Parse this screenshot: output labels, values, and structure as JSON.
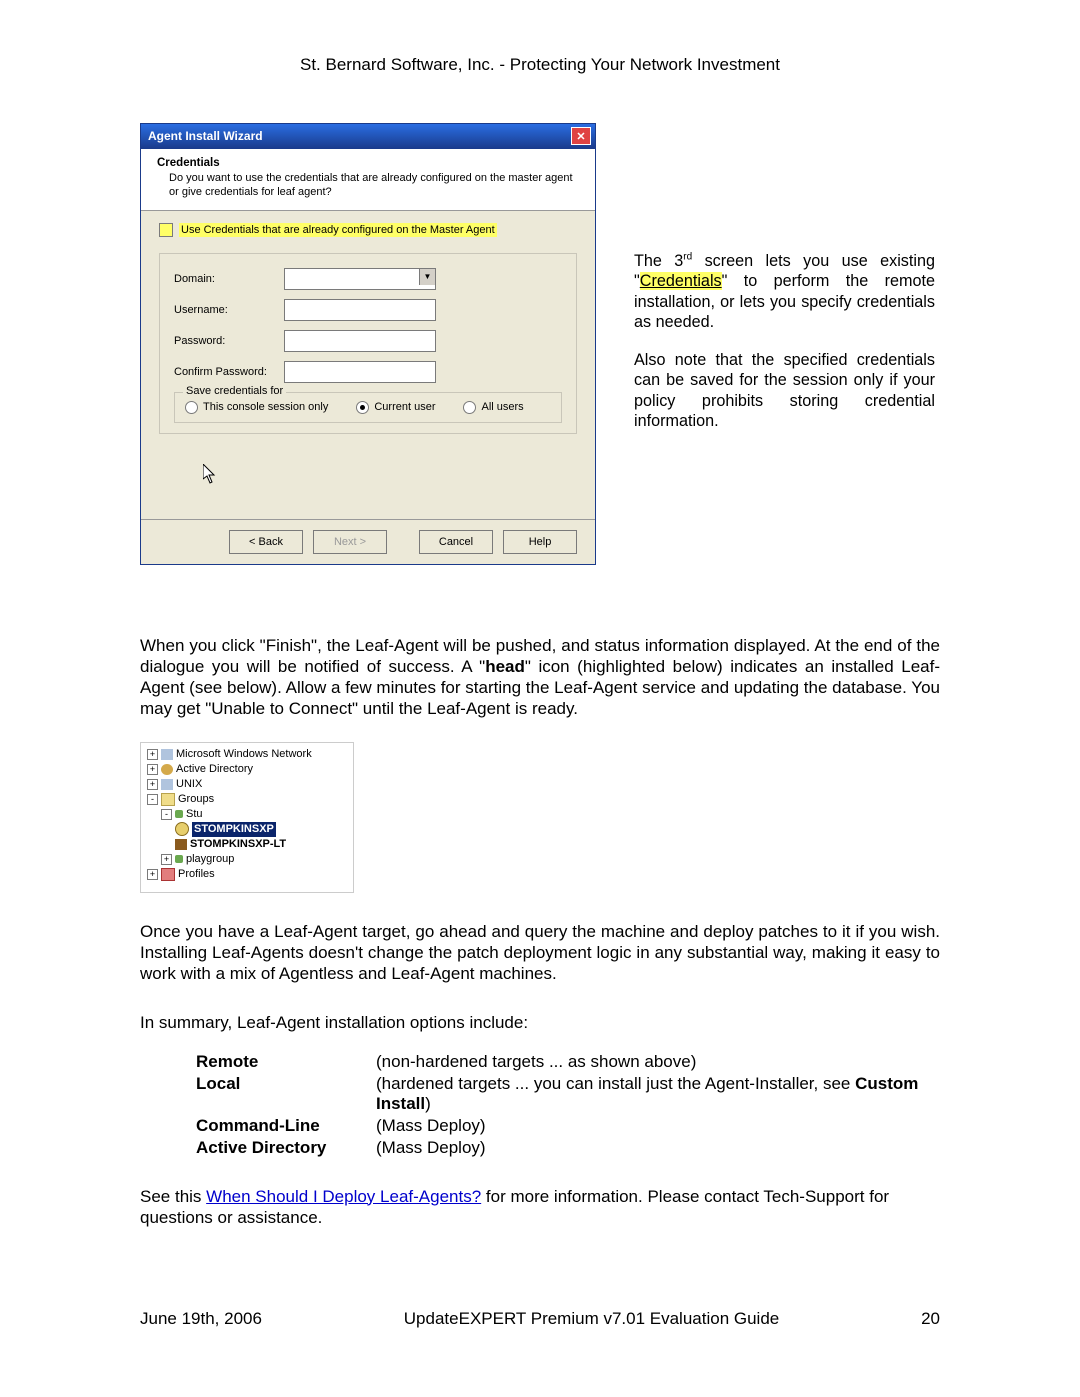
{
  "header_line": "St. Bernard Software, Inc.  -  Protecting Your Network Investment",
  "wizard": {
    "title": "Agent Install Wizard",
    "header_title": "Credentials",
    "header_desc": "Do you want to use the credentials that are already configured on the master agent or give credentials for leaf agent?",
    "master_checkbox_label": "Use Credentials that are already configured on the Master Agent",
    "labels": {
      "domain": "Domain:",
      "username": "Username:",
      "password": "Password:",
      "confirm_password": "Confirm Password:"
    },
    "values": {
      "domain": "",
      "username": "",
      "password": "",
      "confirm_password": ""
    },
    "fieldset_legend": "Save credentials for",
    "radios": {
      "console": "This console session only",
      "current": "Current user",
      "all": "All users",
      "selected": "current"
    },
    "buttons": {
      "back": "< Back",
      "next": "Next >",
      "cancel": "Cancel",
      "help": "Help"
    }
  },
  "caption": {
    "p1_pre": "The 3",
    "p1_sup": "rd",
    "p1_mid": " screen lets you use existing \"",
    "p1_hl": "Credentials",
    "p1_post": "\" to perform the remote installation, or lets you specify credentials as needed.",
    "p2": "Also note that the specified credentials can be saved for the session only if your policy prohibits storing credential information."
  },
  "para_finish_pre": "When you click \"Finish\", the Leaf-Agent will be pushed, and status information displayed.  At the end of the dialogue you will be notified of success.  A \"",
  "para_finish_bold": "head",
  "para_finish_post": "\" icon (highlighted below) indicates an installed Leaf-Agent (see below). Allow a few minutes for starting the Leaf-Agent service and updating the database. You may get \"Unable to Connect\" until the Leaf-Agent is ready.",
  "tree": {
    "nodes": {
      "mwn": "Microsoft Windows Network",
      "ad": "Active Directory",
      "unix": "UNIX",
      "groups": "Groups",
      "stu": "Stu",
      "sel": "STOMPKINSXP",
      "lt": "STOMPKINSXP-LT",
      "play": "playgroup",
      "profiles": "Profiles"
    }
  },
  "para_once": "Once you have a Leaf-Agent target, go ahead and query the machine and deploy patches to it if you wish.  Installing Leaf-Agents doesn't change the patch deployment logic in any substantial way, making it easy to work with a mix of Agentless and Leaf-Agent machines.",
  "para_summary": "In summary, Leaf-Agent installation options include:",
  "options": {
    "remote_key": "Remote",
    "remote_val": "(non-hardened targets ... as shown above)",
    "local_key": "Local",
    "local_val_pre": "(hardened targets ... you can install just the Agent-Installer, see ",
    "local_val_bold": "Custom Install",
    "local_val_post": ")",
    "cmd_key": "Command-Line",
    "cmd_val": "(Mass Deploy)",
    "ad_key": "Active Directory",
    "ad_val": "(Mass Deploy)"
  },
  "see_pre": "See this ",
  "see_link": "When Should I Deploy Leaf-Agents?",
  "see_post": " for more information. Please contact Tech-Support for questions or assistance.",
  "footer": {
    "date": "June 19th, 2006",
    "title": "UpdateEXPERT Premium v7.01 Evaluation Guide",
    "page": "20"
  }
}
